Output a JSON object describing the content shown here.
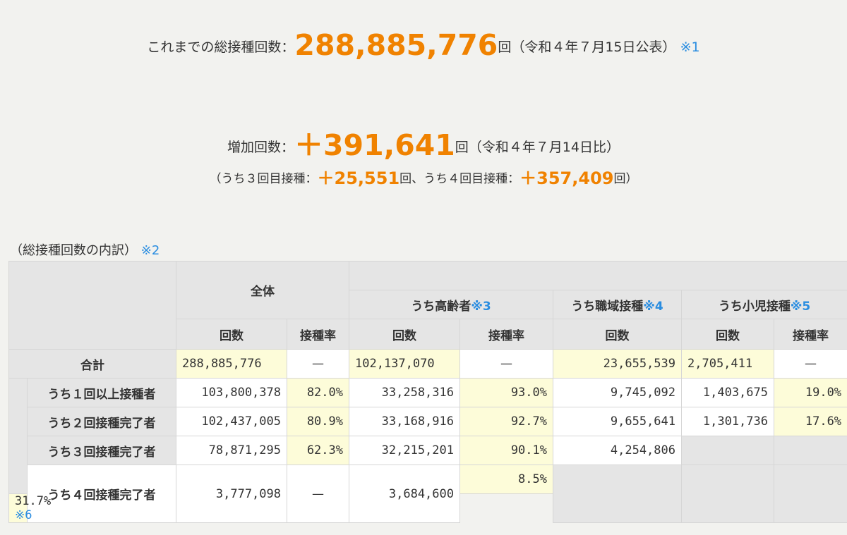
{
  "summary": {
    "total_label": "これまでの総接種回数：",
    "total_value": "288,885,776",
    "total_unit": "回（令和４年７月15日公表）",
    "total_note": "※1",
    "increase_label": "増加回数：",
    "increase_value": "＋391,641",
    "increase_unit": "回（令和４年７月14日比）",
    "sub_prefix": "（うち３回目接種：",
    "sub_third_value": "＋25,551",
    "sub_mid": "回、うち４回目接種：",
    "sub_fourth_value": "＋357,409",
    "sub_suffix": "回）"
  },
  "breakdown": {
    "caption": "（総接種回数の内訳）",
    "caption_note": "※2",
    "groups": {
      "all": "全体",
      "elderly": "うち高齢者",
      "elderly_note": "※3",
      "workplace": "うち職域接種",
      "workplace_note": "※4",
      "child": "うち小児接種",
      "child_note": "※5"
    },
    "col_count": "回数",
    "col_rate": "接種率",
    "dash": "—",
    "rows": {
      "total": {
        "label": "合計",
        "all_count": "288,885,776",
        "elderly_count": "102,137,070",
        "work_count": "23,655,539",
        "child_count": "2,705,411"
      },
      "first": {
        "label": "うち１回以上接種者",
        "all_count": "103,800,378",
        "all_rate": "82.0%",
        "elderly_count": "33,258,316",
        "elderly_rate": "93.0%",
        "work_count": "9,745,092",
        "child_count": "1,403,675",
        "child_rate": "19.0%"
      },
      "second": {
        "label": "うち２回接種完了者",
        "all_count": "102,437,005",
        "all_rate": "80.9%",
        "elderly_count": "33,168,916",
        "elderly_rate": "92.7%",
        "work_count": "9,655,641",
        "child_count": "1,301,736",
        "child_rate": "17.6%"
      },
      "third": {
        "label": "うち３回接種完了者",
        "all_count": "78,871,295",
        "all_rate": "62.3%",
        "elderly_count": "32,215,201",
        "elderly_rate": "90.1%",
        "work_count": "4,254,806"
      },
      "fourth": {
        "label": "うち４回接種完了者",
        "all_count": "3,777,098",
        "elderly_count": "3,684,600",
        "elderly_rate": "8.5%",
        "elderly_rate_b": "31.7%",
        "elderly_rate_b_note": "※6"
      }
    }
  }
}
